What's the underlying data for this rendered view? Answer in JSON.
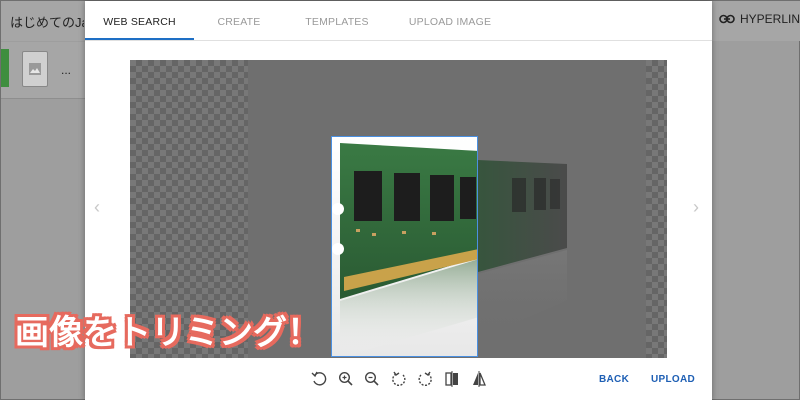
{
  "background": {
    "doc_title": "はじめてのJa",
    "hyperlink_label": "HYPERLINK",
    "thumb_more": "..."
  },
  "dialog": {
    "tabs": [
      {
        "label": "WEB SEARCH",
        "active": true
      },
      {
        "label": "CREATE",
        "active": false
      },
      {
        "label": "TEMPLATES",
        "active": false
      },
      {
        "label": "UPLOAD IMAGE",
        "active": false
      }
    ],
    "nav": {
      "prev": "‹",
      "next": "›"
    },
    "toolbar_icons": [
      "rotate-left-icon",
      "zoom-in-icon",
      "zoom-out-icon",
      "rotate-ccw-icon",
      "rotate-cw-icon",
      "flip-horizontal-icon",
      "mirror-icon"
    ],
    "actions": {
      "back": "BACK",
      "upload": "UPLOAD"
    }
  },
  "caption": "画像をトリミング！",
  "colors": {
    "accent": "#1e6fc5",
    "action_text": "#1e5fb4",
    "crop_border": "#4a90e2",
    "caption_outline": "#e66a5e",
    "pcb_green": "#2f6b3a"
  }
}
